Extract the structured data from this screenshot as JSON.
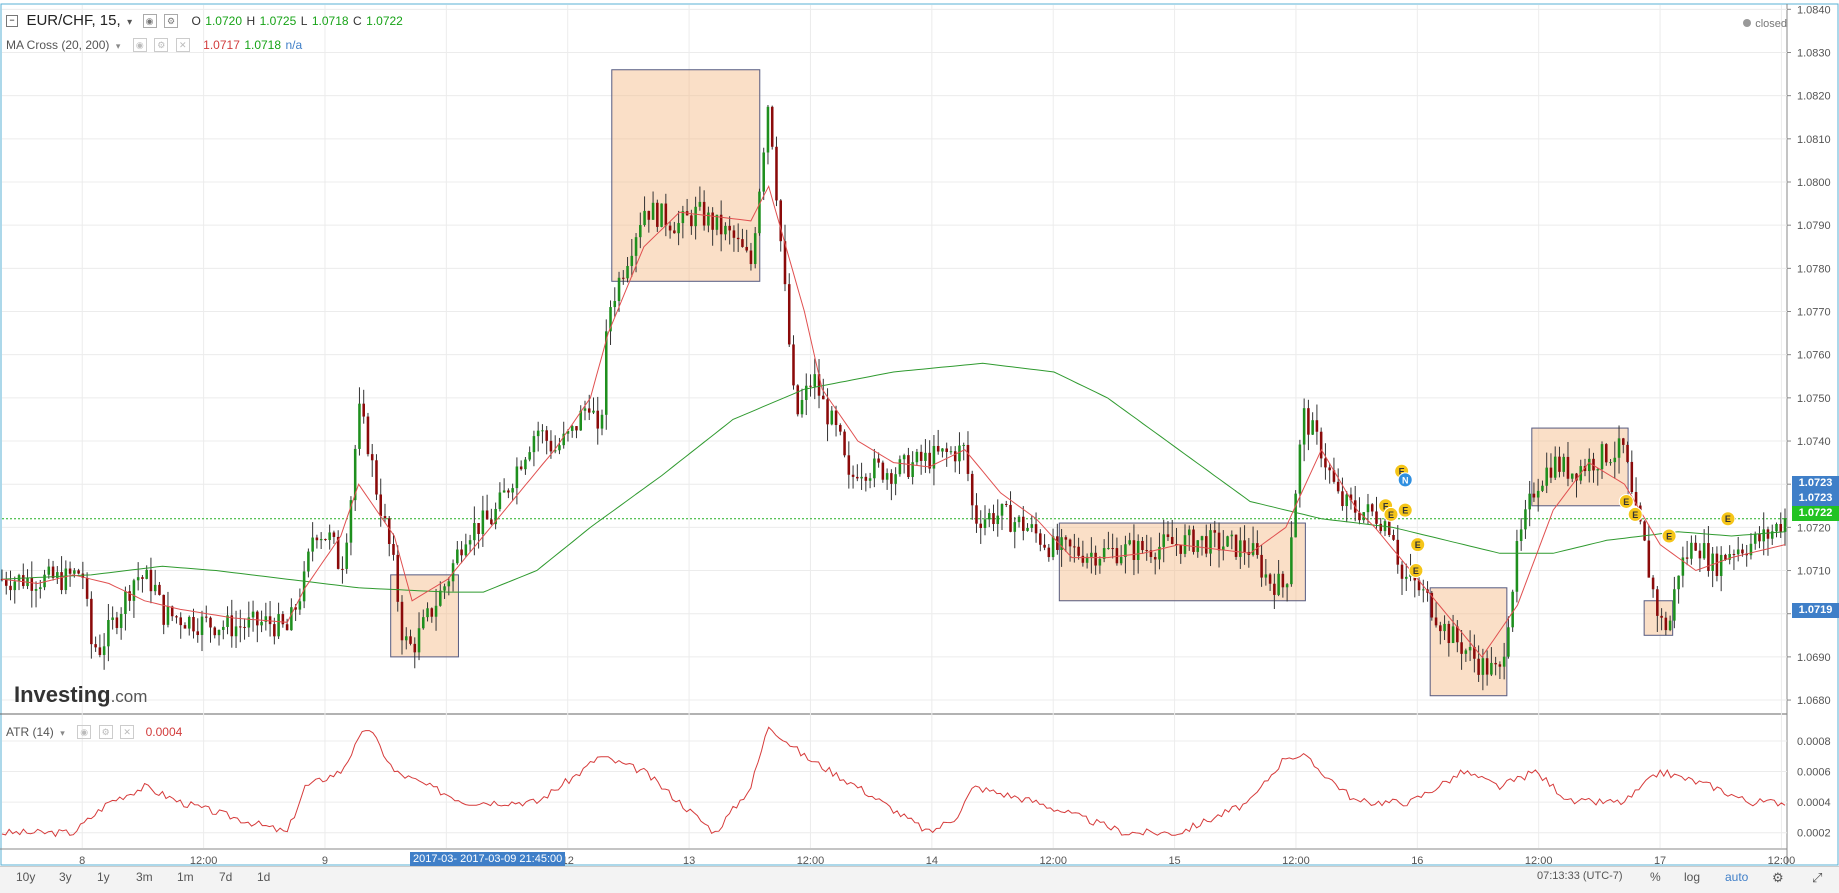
{
  "header": {
    "symbol": "EUR/CHF, 15,",
    "open_label": "O",
    "open": "1.0720",
    "high_label": "H",
    "high": "1.0725",
    "low_label": "L",
    "low": "1.0718",
    "close_label": "C",
    "close": "1.0722",
    "status": "closed"
  },
  "indicator": {
    "name": "MA Cross (20, 200)",
    "value1": "1.0717",
    "value2": "1.0718",
    "value3": "n/a"
  },
  "atr": {
    "name": "ATR (14)",
    "value": "0.0004"
  },
  "watermark": {
    "brand": "Investing",
    "suffix": ".com"
  },
  "crosshair_label": "2017-03-  2017-03-09 21:45:00",
  "bottom_bar": {
    "ranges": [
      "10y",
      "3y",
      "1y",
      "3m",
      "1m",
      "7d",
      "1d"
    ],
    "time": "07:13:33 (UTC-7)",
    "percent": "%",
    "log": "log",
    "auto": "auto"
  },
  "price_tags": [
    {
      "label": "1.0723",
      "color": "#3f7fc8"
    },
    {
      "label": "1.0723",
      "color": "#3f7fc8"
    },
    {
      "label": "1.0722",
      "color": "#22c322"
    },
    {
      "label": "1.0719",
      "color": "#3f7fc8"
    }
  ],
  "chart_data": {
    "type": "candlestick",
    "symbol": "EUR/CHF",
    "interval": "15",
    "y_axis_ticks": [
      "1.0840",
      "1.0830",
      "1.0820",
      "1.0810",
      "1.0800",
      "1.0790",
      "1.0780",
      "1.0770",
      "1.0760",
      "1.0750",
      "1.0740",
      "1.0730",
      "1.0720",
      "1.0710",
      "1.0700",
      "1.0690",
      "1.0680"
    ],
    "y_range": [
      1.0677,
      1.0841
    ],
    "x_axis_ticks": [
      "8",
      "12:00",
      "9",
      "12:00",
      "12",
      "13",
      "12:00",
      "14",
      "12:00",
      "15",
      "12:00",
      "16",
      "12:00",
      "17",
      "12:00"
    ],
    "price_line": 1.0722,
    "ma20_anchors": [
      [
        0,
        1.0708
      ],
      [
        0.02,
        1.0707
      ],
      [
        0.04,
        1.0709
      ],
      [
        0.06,
        1.0707
      ],
      [
        0.08,
        1.0703
      ],
      [
        0.1,
        1.0701
      ],
      [
        0.13,
        1.0699
      ],
      [
        0.16,
        1.0698
      ],
      [
        0.17,
        1.0706
      ],
      [
        0.19,
        1.0718
      ],
      [
        0.2,
        1.073
      ],
      [
        0.22,
        1.0718
      ],
      [
        0.23,
        1.0703
      ],
      [
        0.25,
        1.0708
      ],
      [
        0.27,
        1.0718
      ],
      [
        0.29,
        1.0728
      ],
      [
        0.31,
        1.0738
      ],
      [
        0.33,
        1.075
      ],
      [
        0.34,
        1.0765
      ],
      [
        0.36,
        1.0785
      ],
      [
        0.38,
        1.0793
      ],
      [
        0.4,
        1.0792
      ],
      [
        0.42,
        1.0791
      ],
      [
        0.43,
        1.0799
      ],
      [
        0.45,
        1.077
      ],
      [
        0.46,
        1.0752
      ],
      [
        0.48,
        1.074
      ],
      [
        0.5,
        1.0735
      ],
      [
        0.52,
        1.0734
      ],
      [
        0.54,
        1.0738
      ],
      [
        0.56,
        1.0728
      ],
      [
        0.58,
        1.0722
      ],
      [
        0.6,
        1.0713
      ],
      [
        0.62,
        1.0713
      ],
      [
        0.64,
        1.0714
      ],
      [
        0.66,
        1.0716
      ],
      [
        0.7,
        1.0714
      ],
      [
        0.72,
        1.072
      ],
      [
        0.74,
        1.0738
      ],
      [
        0.76,
        1.0724
      ],
      [
        0.77,
        1.072
      ],
      [
        0.79,
        1.071
      ],
      [
        0.81,
        1.07
      ],
      [
        0.83,
        1.069
      ],
      [
        0.85,
        1.0702
      ],
      [
        0.87,
        1.0724
      ],
      [
        0.89,
        1.0735
      ],
      [
        0.91,
        1.073
      ],
      [
        0.93,
        1.0716
      ],
      [
        0.95,
        1.071
      ],
      [
        0.97,
        1.0713
      ],
      [
        1.0,
        1.0716
      ]
    ],
    "ma200_anchors": [
      [
        0,
        1.0708
      ],
      [
        0.05,
        1.0709
      ],
      [
        0.09,
        1.0711
      ],
      [
        0.12,
        1.071
      ],
      [
        0.16,
        1.0708
      ],
      [
        0.2,
        1.0706
      ],
      [
        0.25,
        1.0705
      ],
      [
        0.27,
        1.0705
      ],
      [
        0.3,
        1.071
      ],
      [
        0.33,
        1.072
      ],
      [
        0.37,
        1.0732
      ],
      [
        0.41,
        1.0745
      ],
      [
        0.45,
        1.0752
      ],
      [
        0.5,
        1.0756
      ],
      [
        0.55,
        1.0758
      ],
      [
        0.59,
        1.0756
      ],
      [
        0.62,
        1.075
      ],
      [
        0.66,
        1.0738
      ],
      [
        0.7,
        1.0726
      ],
      [
        0.74,
        1.0722
      ],
      [
        0.78,
        1.072
      ],
      [
        0.81,
        1.0717
      ],
      [
        0.84,
        1.0714
      ],
      [
        0.87,
        1.0714
      ],
      [
        0.9,
        1.0717
      ],
      [
        0.94,
        1.0719
      ],
      [
        0.97,
        1.0718
      ],
      [
        1.0,
        1.0719
      ]
    ],
    "price_anchors": [
      [
        0,
        1.0708
      ],
      [
        0.02,
        1.0708
      ],
      [
        0.035,
        1.0708
      ],
      [
        0.045,
        1.071
      ],
      [
        0.05,
        1.0693
      ],
      [
        0.055,
        1.0692
      ],
      [
        0.065,
        1.07
      ],
      [
        0.075,
        1.0709
      ],
      [
        0.085,
        1.0707
      ],
      [
        0.09,
        1.07
      ],
      [
        0.1,
        1.0699
      ],
      [
        0.11,
        1.0698
      ],
      [
        0.13,
        1.0697
      ],
      [
        0.15,
        1.0698
      ],
      [
        0.16,
        1.0696
      ],
      [
        0.17,
        1.0708
      ],
      [
        0.175,
        1.072
      ],
      [
        0.185,
        1.0717
      ],
      [
        0.19,
        1.071
      ],
      [
        0.195,
        1.0724
      ],
      [
        0.2,
        1.0747
      ],
      [
        0.205,
        1.074
      ],
      [
        0.21,
        1.0729
      ],
      [
        0.215,
        1.072
      ],
      [
        0.22,
        1.071
      ],
      [
        0.225,
        1.0694
      ],
      [
        0.23,
        1.0692
      ],
      [
        0.24,
        1.07
      ],
      [
        0.25,
        1.0708
      ],
      [
        0.26,
        1.0719
      ],
      [
        0.275,
        1.0722
      ],
      [
        0.28,
        1.0726
      ],
      [
        0.29,
        1.0735
      ],
      [
        0.3,
        1.0743
      ],
      [
        0.31,
        1.0738
      ],
      [
        0.32,
        1.0742
      ],
      [
        0.33,
        1.075
      ],
      [
        0.335,
        1.0738
      ],
      [
        0.34,
        1.077
      ],
      [
        0.35,
        1.0782
      ],
      [
        0.36,
        1.0794
      ],
      [
        0.37,
        1.0792
      ],
      [
        0.38,
        1.079
      ],
      [
        0.39,
        1.0793
      ],
      [
        0.4,
        1.079
      ],
      [
        0.41,
        1.0787
      ],
      [
        0.42,
        1.0781
      ],
      [
        0.425,
        1.08
      ],
      [
        0.43,
        1.082
      ],
      [
        0.435,
        1.0795
      ],
      [
        0.44,
        1.077
      ],
      [
        0.445,
        1.0745
      ],
      [
        0.455,
        1.0755
      ],
      [
        0.46,
        1.0749
      ],
      [
        0.47,
        1.074
      ],
      [
        0.475,
        1.073
      ],
      [
        0.48,
        1.0734
      ],
      [
        0.5,
        1.0733
      ],
      [
        0.52,
        1.0736
      ],
      [
        0.54,
        1.0738
      ],
      [
        0.545,
        1.0722
      ],
      [
        0.56,
        1.0723
      ],
      [
        0.575,
        1.072
      ],
      [
        0.59,
        1.0715
      ],
      [
        0.61,
        1.0714
      ],
      [
        0.64,
        1.0715
      ],
      [
        0.67,
        1.0717
      ],
      [
        0.7,
        1.0715
      ],
      [
        0.71,
        1.0708
      ],
      [
        0.72,
        1.0706
      ],
      [
        0.725,
        1.0727
      ],
      [
        0.73,
        1.0746
      ],
      [
        0.74,
        1.0738
      ],
      [
        0.75,
        1.0726
      ],
      [
        0.76,
        1.0724
      ],
      [
        0.77,
        1.0723
      ],
      [
        0.78,
        1.072
      ],
      [
        0.785,
        1.0708
      ],
      [
        0.79,
        1.0708
      ],
      [
        0.8,
        1.0703
      ],
      [
        0.81,
        1.0696
      ],
      [
        0.82,
        1.0692
      ],
      [
        0.83,
        1.0688
      ],
      [
        0.84,
        1.0686
      ],
      [
        0.845,
        1.07
      ],
      [
        0.85,
        1.0715
      ],
      [
        0.86,
        1.073
      ],
      [
        0.87,
        1.0735
      ],
      [
        0.88,
        1.0733
      ],
      [
        0.89,
        1.0735
      ],
      [
        0.9,
        1.0737
      ],
      [
        0.91,
        1.0738
      ],
      [
        0.915,
        1.0724
      ],
      [
        0.92,
        1.0718
      ],
      [
        0.925,
        1.0707
      ],
      [
        0.93,
        1.0698
      ],
      [
        0.935,
        1.0697
      ],
      [
        0.94,
        1.071
      ],
      [
        0.95,
        1.0717
      ],
      [
        0.96,
        1.0711
      ],
      [
        0.97,
        1.0715
      ],
      [
        0.98,
        1.0716
      ],
      [
        0.99,
        1.0718
      ],
      [
        1.0,
        1.0722
      ]
    ],
    "atr_ticks": [
      "0.0008",
      "0.0006",
      "0.0004",
      "0.0002"
    ],
    "atr_range": [
      0.0001,
      0.00095
    ],
    "atr_anchors": [
      [
        0,
        0.0002
      ],
      [
        0.04,
        0.0002
      ],
      [
        0.06,
        0.0004
      ],
      [
        0.08,
        0.0005
      ],
      [
        0.1,
        0.0004
      ],
      [
        0.13,
        0.0003
      ],
      [
        0.16,
        0.0002
      ],
      [
        0.17,
        0.0005
      ],
      [
        0.19,
        0.0006
      ],
      [
        0.205,
        0.0009
      ],
      [
        0.22,
        0.0006
      ],
      [
        0.26,
        0.0004
      ],
      [
        0.3,
        0.0004
      ],
      [
        0.325,
        0.0006
      ],
      [
        0.335,
        0.0007
      ],
      [
        0.36,
        0.0006
      ],
      [
        0.4,
        0.0002
      ],
      [
        0.42,
        0.0005
      ],
      [
        0.43,
        0.0009
      ],
      [
        0.45,
        0.0007
      ],
      [
        0.48,
        0.0005
      ],
      [
        0.52,
        0.0002
      ],
      [
        0.535,
        0.0003
      ],
      [
        0.545,
        0.0005
      ],
      [
        0.58,
        0.0004
      ],
      [
        0.63,
        0.0002
      ],
      [
        0.66,
        0.0002
      ],
      [
        0.7,
        0.0004
      ],
      [
        0.72,
        0.0007
      ],
      [
        0.73,
        0.0007
      ],
      [
        0.76,
        0.0004
      ],
      [
        0.79,
        0.0004
      ],
      [
        0.82,
        0.0006
      ],
      [
        0.84,
        0.0005
      ],
      [
        0.86,
        0.0006
      ],
      [
        0.88,
        0.0004
      ],
      [
        0.91,
        0.0004
      ],
      [
        0.93,
        0.0006
      ],
      [
        0.96,
        0.0005
      ],
      [
        0.98,
        0.0004
      ],
      [
        1.0,
        0.0004
      ]
    ],
    "rectangles": [
      {
        "x0": 0.218,
        "x1": 0.256,
        "y0": 1.069,
        "y1": 1.0709
      },
      {
        "x0": 0.342,
        "x1": 0.425,
        "y0": 1.0777,
        "y1": 1.0826
      },
      {
        "x0": 0.593,
        "x1": 0.731,
        "y0": 1.0703,
        "y1": 1.0721
      },
      {
        "x0": 0.801,
        "x1": 0.844,
        "y0": 1.0681,
        "y1": 1.0706
      },
      {
        "x0": 0.858,
        "x1": 0.912,
        "y0": 1.0725,
        "y1": 1.0743
      },
      {
        "x0": 0.921,
        "x1": 0.937,
        "y0": 1.0695,
        "y1": 1.0703
      }
    ],
    "event_markers": [
      {
        "x": 0.785,
        "y": 1.0733,
        "label": "E"
      },
      {
        "x": 0.787,
        "y": 1.0731,
        "label": "N"
      },
      {
        "x": 0.776,
        "y": 1.0725,
        "label": "F"
      },
      {
        "x": 0.779,
        "y": 1.0723,
        "label": "E"
      },
      {
        "x": 0.787,
        "y": 1.0724,
        "label": "E"
      },
      {
        "x": 0.794,
        "y": 1.0716,
        "label": "E"
      },
      {
        "x": 0.793,
        "y": 1.071,
        "label": "E"
      },
      {
        "x": 0.911,
        "y": 1.0726,
        "label": "E"
      },
      {
        "x": 0.916,
        "y": 1.0723,
        "label": "E"
      },
      {
        "x": 0.935,
        "y": 1.0718,
        "label": "E"
      },
      {
        "x": 0.968,
        "y": 1.0722,
        "label": "E"
      }
    ]
  }
}
